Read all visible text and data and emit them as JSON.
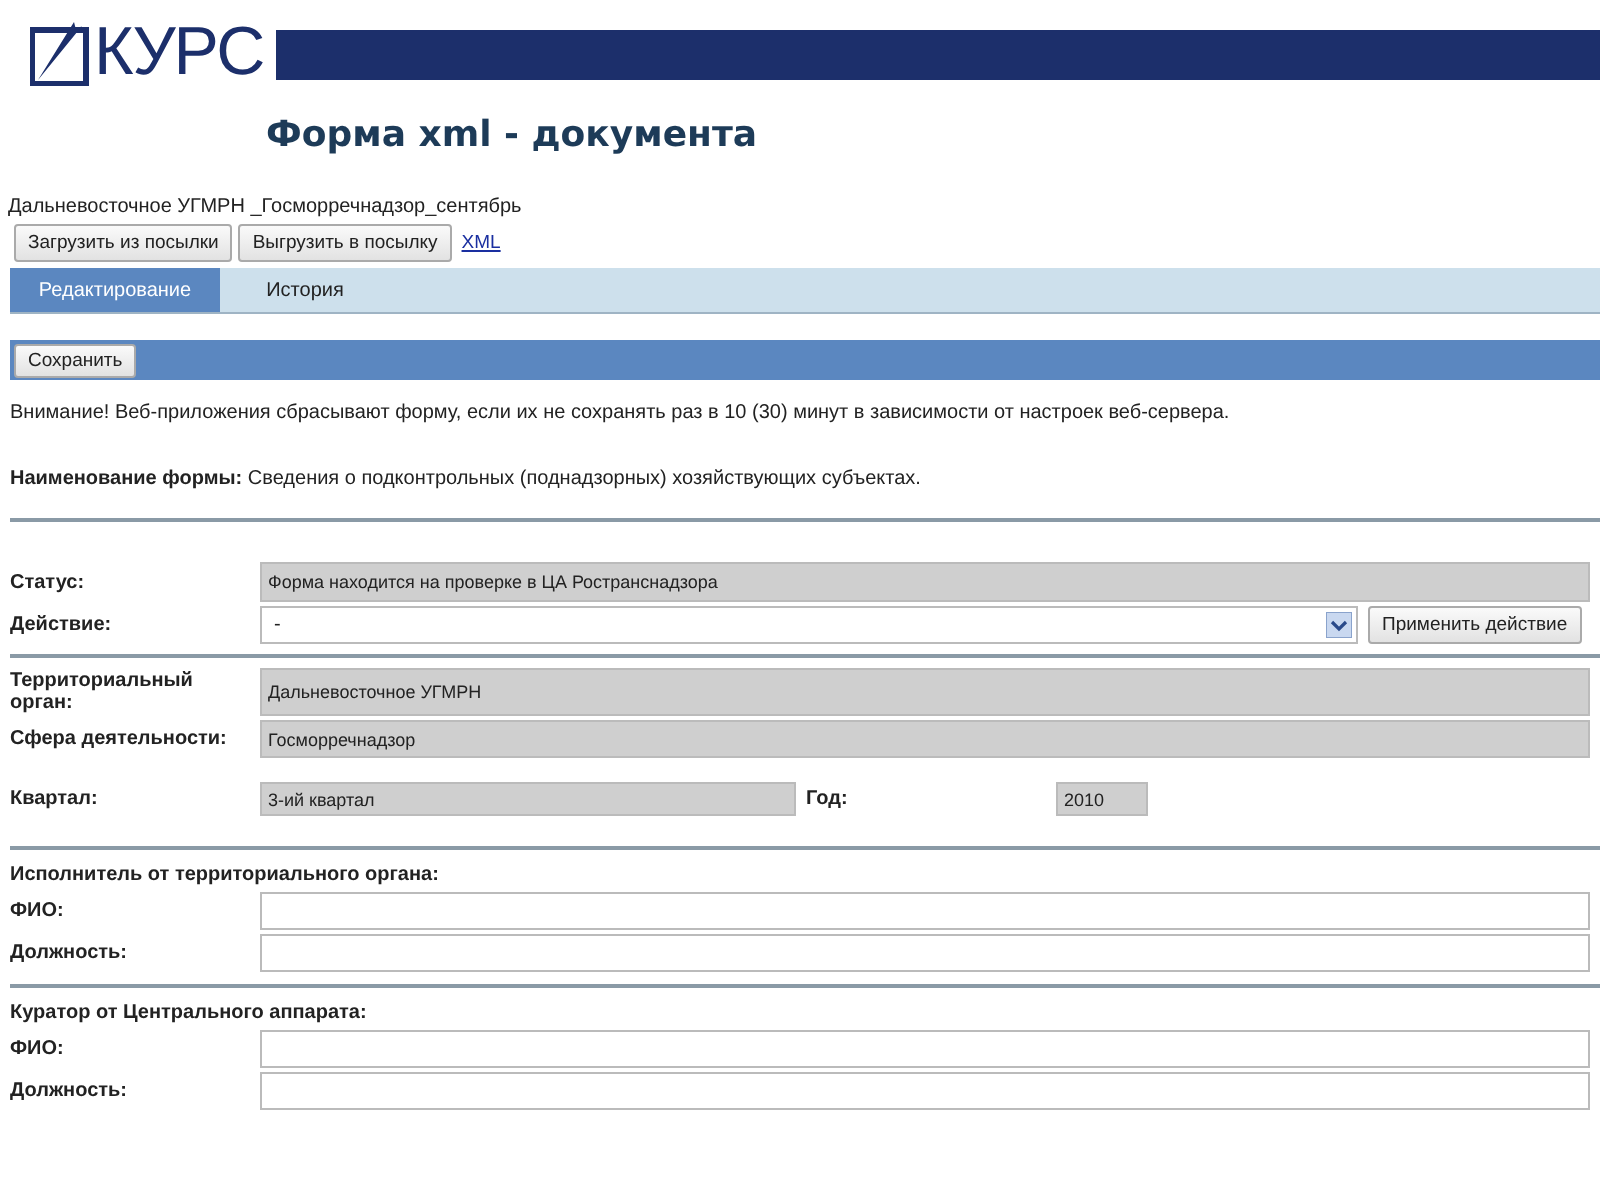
{
  "header": {
    "logo": "КУРС",
    "title": "Форма xml - документа"
  },
  "document_name": "Дальневосточное УГМРН _Госморречнадзор_сентябрь",
  "toolbar": {
    "buttons": [
      "Загрузить из посылки",
      "Выгрузить в посылку"
    ],
    "link": "XML"
  },
  "tabs": [
    {
      "label": "Редактирование",
      "selected": true
    },
    {
      "label": "История",
      "selected": false
    }
  ],
  "save_button": "Сохранить",
  "warning": "Внимание! Веб-приложения сбрасывают форму, если их не сохранять раз в 10 (30) минут в зависимости от настроек веб-сервера.",
  "form_name": "**Наименование формы:** Сведения о подконтрольных (поднадзорных) хозяйствующих субъектах.",
  "status": {
    "label": "Статус:",
    "value": "Форма находится на проверке в ЦА Ространснадзора"
  },
  "action": {
    "label": "Действие:",
    "value": "-",
    "button": "Применить действие"
  },
  "organization": [
    {
      "label": "Территориальный орган:",
      "value": "Дальневосточное УГМРН"
    },
    {
      "label": "Сфера деятельности:",
      "value": "Госморречнадзор"
    }
  ],
  "period": {
    "quarter_label": "Квартал:",
    "quarter": "3-ий квартал",
    "year_label": "Год:",
    "year": "2010"
  },
  "contacts": [
    {
      "heading": "Исполнитель от территориального органа:",
      "fields": [
        "ФИО:",
        "Должность:"
      ]
    },
    {
      "heading": "Куратор от Центрального аппарата:",
      "fields": [
        "ФИО:",
        "Должность:"
      ]
    }
  ]
}
